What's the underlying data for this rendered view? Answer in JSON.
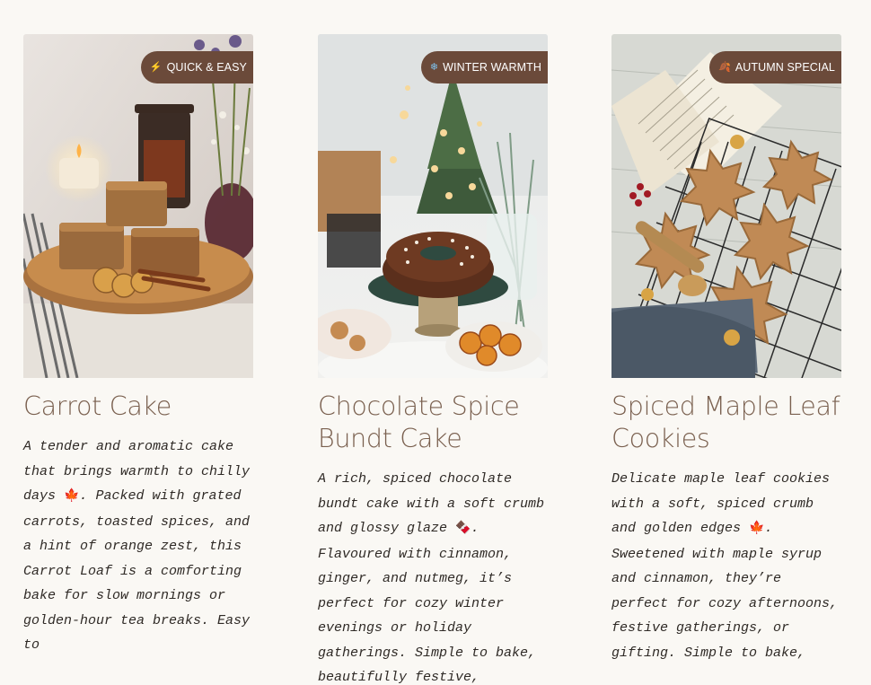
{
  "cards": [
    {
      "badge": {
        "icon": "lightning-icon",
        "glyph": "⚡",
        "label": "QUICK & EASY"
      },
      "title": "Carrot Cake",
      "desc_parts": [
        "A tender and aromatic cake that brings warmth to chilly days ",
        "🍁",
        ". Packed with grated carrots, toasted spices, and a hint of orange zest, this Carrot Loaf is a comforting bake for slow mornings or golden-hour tea breaks. Easy to"
      ]
    },
    {
      "badge": {
        "icon": "snowflake-icon",
        "glyph": "❄",
        "label": "WINTER WARMTH"
      },
      "title": "Chocolate Spice Bundt Cake",
      "desc_parts": [
        "A rich, spiced chocolate bundt cake with a soft crumb and glossy glaze ",
        "🍫",
        ". Flavoured with cinnamon, ginger, and nutmeg, it’s perfect for cozy winter evenings or holiday gatherings. Simple to bake, beautifully festive,"
      ]
    },
    {
      "badge": {
        "icon": "autumn-leaf-icon",
        "glyph": "🍂",
        "label": "AUTUMN SPECIAL"
      },
      "title": "Spiced Maple Leaf Cookies",
      "desc_parts": [
        "Delicate maple leaf cookies with a soft, spiced crumb and golden edges ",
        "🍁",
        ". Sweetened with maple syrup and cinnamon, they’re perfect for cozy afternoons, festive gatherings, or gifting. Simple to bake,"
      ]
    }
  ],
  "colors": {
    "page_bg": "#faf8f4",
    "badge_bg": "#6b4a3a",
    "title": "#7a604f",
    "body_text": "#2f2a26"
  }
}
